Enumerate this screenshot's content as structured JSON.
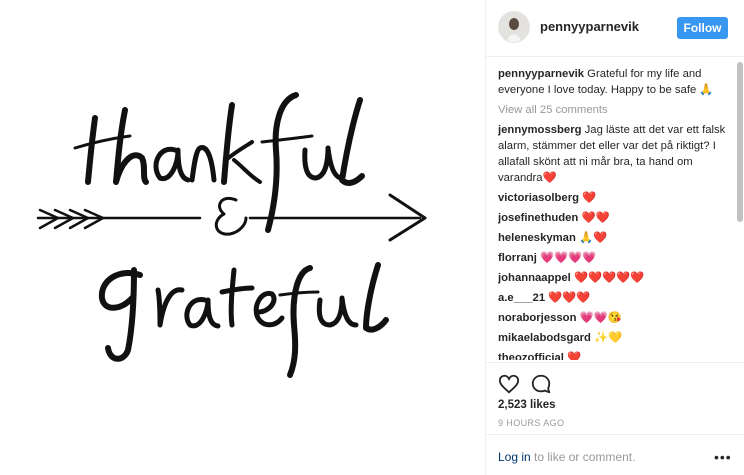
{
  "post": {
    "username": "pennyyparnevik",
    "follow_label": "Follow",
    "caption_user": "pennyyparnevik",
    "caption_text": "Grateful for my life and everyone I love today. Happy to be safe 🙏",
    "view_all": "View all 25 comments",
    "comments": [
      {
        "user": "jennymossberg",
        "text": "Jag läste att det var ett falsk alarm, stämmer det eller var det på riktigt? I allafall skönt att ni mår bra, ta hand om varandra❤️"
      },
      {
        "user": "victoriasolberg",
        "text": "❤️"
      },
      {
        "user": "josefinethuden",
        "text": "❤️❤️"
      },
      {
        "user": "heleneskyman",
        "text": "🙏❤️"
      },
      {
        "user": "florranj",
        "text": "💗💗💗💗"
      },
      {
        "user": "johannaappel",
        "text": "❤️❤️❤️❤️❤️"
      },
      {
        "user": "a.e___21",
        "text": "❤️❤️❤️"
      },
      {
        "user": "noraborjesson",
        "text": "💗💗😘"
      },
      {
        "user": "mikaelabodsgard",
        "text": "✨💛"
      },
      {
        "user": "theozofficial",
        "text": "❤️"
      }
    ],
    "likes": "2,523 likes",
    "time": "9 HOURS AGO"
  },
  "footer": {
    "login_label": "Log in",
    "rest": " to like or comment.",
    "more": "•••"
  }
}
